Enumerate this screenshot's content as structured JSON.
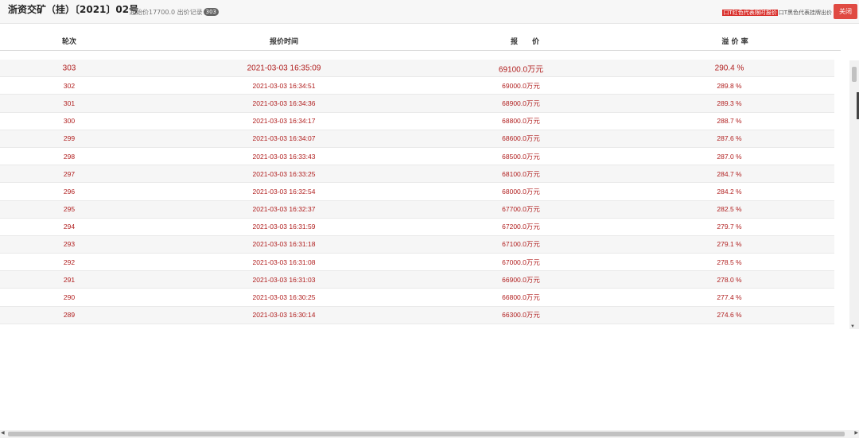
{
  "header": {
    "title": "浙资交矿（挂）〔2021〕02号",
    "start_price": "起始价17700.0",
    "bid_record_label": "出价记录",
    "bid_count": "303",
    "legend_red": "口T红色代表限时报价",
    "legend_black": "口T黑色代表挂牌出价",
    "close_label": "关闭"
  },
  "table": {
    "columns": [
      "轮次",
      "报价时间",
      "报　　价",
      "溢 价 率"
    ],
    "rows": [
      {
        "round": "303",
        "time": "2021-03-03 16:35:09",
        "price": "69100.0万元",
        "premium": "290.4 %"
      },
      {
        "round": "302",
        "time": "2021-03-03 16:34:51",
        "price": "69000.0万元",
        "premium": "289.8 %"
      },
      {
        "round": "301",
        "time": "2021-03-03 16:34:36",
        "price": "68900.0万元",
        "premium": "289.3 %"
      },
      {
        "round": "300",
        "time": "2021-03-03 16:34:17",
        "price": "68800.0万元",
        "premium": "288.7 %"
      },
      {
        "round": "299",
        "time": "2021-03-03 16:34:07",
        "price": "68600.0万元",
        "premium": "287.6 %"
      },
      {
        "round": "298",
        "time": "2021-03-03 16:33:43",
        "price": "68500.0万元",
        "premium": "287.0 %"
      },
      {
        "round": "297",
        "time": "2021-03-03 16:33:25",
        "price": "68100.0万元",
        "premium": "284.7 %"
      },
      {
        "round": "296",
        "time": "2021-03-03 16:32:54",
        "price": "68000.0万元",
        "premium": "284.2 %"
      },
      {
        "round": "295",
        "time": "2021-03-03 16:32:37",
        "price": "67700.0万元",
        "premium": "282.5 %"
      },
      {
        "round": "294",
        "time": "2021-03-03 16:31:59",
        "price": "67200.0万元",
        "premium": "279.7 %"
      },
      {
        "round": "293",
        "time": "2021-03-03 16:31:18",
        "price": "67100.0万元",
        "premium": "279.1 %"
      },
      {
        "round": "292",
        "time": "2021-03-03 16:31:08",
        "price": "67000.0万元",
        "premium": "278.5 %"
      },
      {
        "round": "291",
        "time": "2021-03-03 16:31:03",
        "price": "66900.0万元",
        "premium": "278.0 %"
      },
      {
        "round": "290",
        "time": "2021-03-03 16:30:25",
        "price": "66800.0万元",
        "premium": "277.4 %"
      },
      {
        "round": "289",
        "time": "2021-03-03 16:30:14",
        "price": "66300.0万元",
        "premium": "274.6 %"
      }
    ]
  },
  "colors": {
    "value_text": "#b01d1d",
    "close_button": "#e04a42",
    "legend_red": "#d9302c"
  },
  "icons": {
    "scroll_up": "triangle-up",
    "scroll_down": "triangle-down",
    "scroll_left": "triangle-left",
    "scroll_right": "triangle-right"
  }
}
